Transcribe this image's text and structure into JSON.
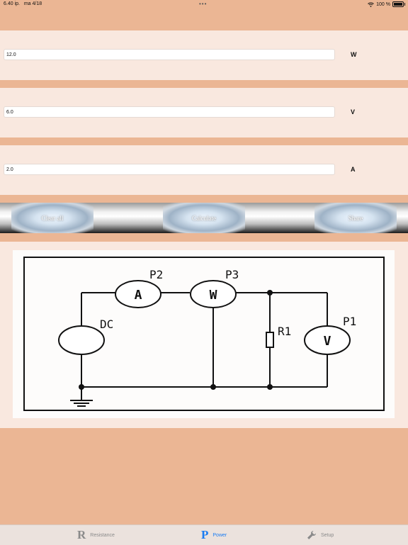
{
  "status_bar": {
    "time": "6.40 ip.",
    "date": "ma 4/18",
    "battery": "100 %"
  },
  "fields": [
    {
      "value": "12.0",
      "unit": "W"
    },
    {
      "value": "6.0",
      "unit": "V"
    },
    {
      "value": "2.0",
      "unit": "A"
    }
  ],
  "buttons": {
    "clear_all": "Clear all",
    "calculate": "Calculate",
    "share": "Share"
  },
  "diagram": {
    "labels": {
      "ammeter": "A",
      "wattmeter": "W",
      "voltmeter": "V",
      "p2": "P2",
      "p3": "P3",
      "p1": "P1",
      "dc": "DC",
      "r1": "R1"
    }
  },
  "tabs": [
    {
      "glyph": "R",
      "label": "Resistance",
      "active": false
    },
    {
      "glyph": "P",
      "label": "Power",
      "active": true
    },
    {
      "glyph": "wrench-icon",
      "label": "Setup",
      "active": false
    }
  ],
  "colors": {
    "background": "#ebb694",
    "panel": "#f9e8df",
    "active_tab": "#1a7cf2",
    "inactive_tab": "#8a8a8a"
  }
}
